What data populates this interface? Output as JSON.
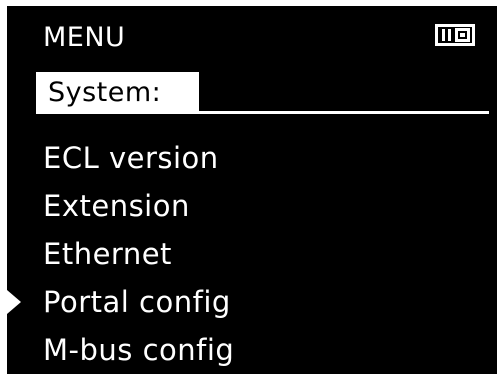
{
  "header": {
    "title": "MENU",
    "mode_icon": "display-mode-icon"
  },
  "section": {
    "label": "System:"
  },
  "menu": {
    "items": [
      {
        "label": "ECL version",
        "selected": false
      },
      {
        "label": "Extension",
        "selected": false
      },
      {
        "label": "Ethernet",
        "selected": false
      },
      {
        "label": "Portal config",
        "selected": true
      },
      {
        "label": "M-bus config",
        "selected": false
      }
    ]
  },
  "colors": {
    "screen_bg": "#000000",
    "foreground": "#ffffff"
  }
}
